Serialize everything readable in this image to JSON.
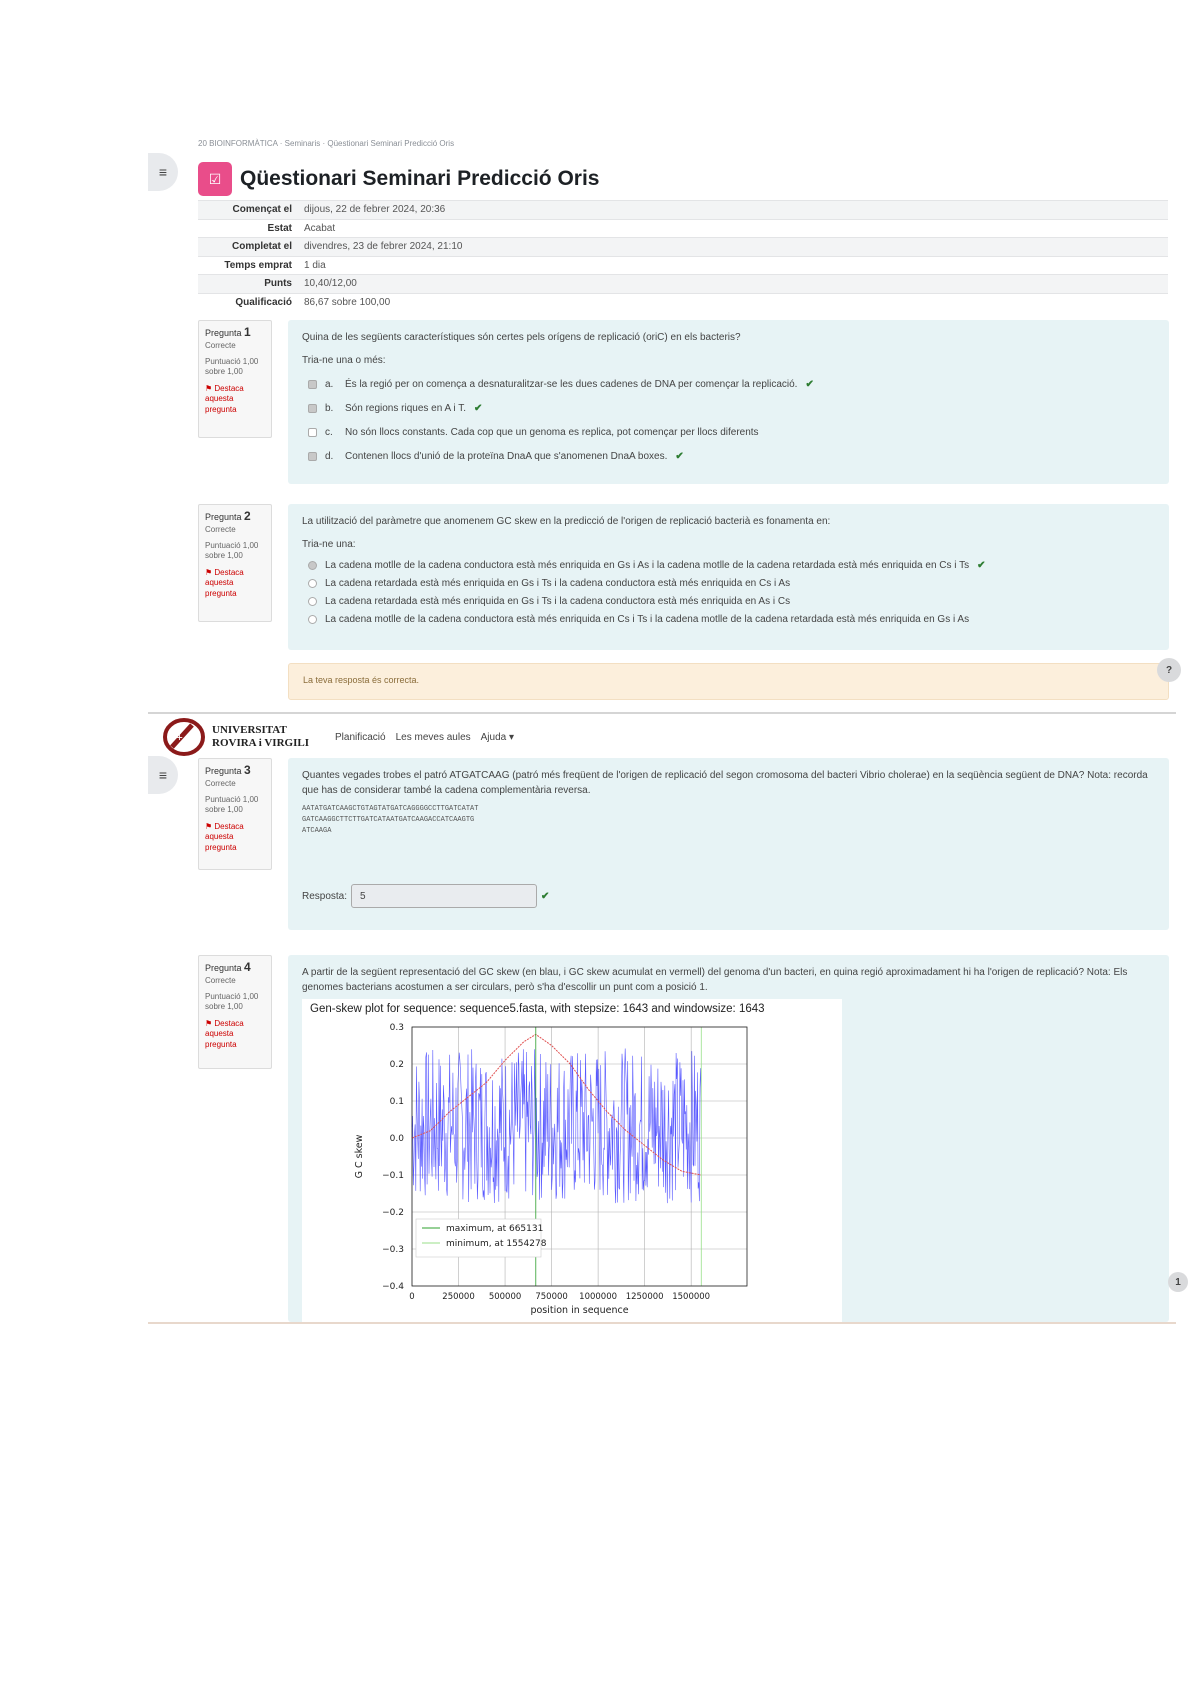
{
  "header": {
    "breadcrumb": "20 BIOINFORMÀTICA · Seminaris · Qüestionari Seminari Predicció Oris",
    "title": "Qüestionari Seminari Predicció Oris"
  },
  "summary": [
    {
      "label": "Començat el",
      "value": "dijous, 22 de febrer 2024, 20:36"
    },
    {
      "label": "Estat",
      "value": "Acabat"
    },
    {
      "label": "Completat el",
      "value": "divendres, 23 de febrer 2024, 21:10"
    },
    {
      "label": "Temps emprat",
      "value": "1 dia"
    },
    {
      "label": "Punts",
      "value": "10,40/12,00"
    },
    {
      "label": "Qualificació",
      "value": "86,67 sobre 100,00"
    }
  ],
  "questions": [
    {
      "no_label": "Pregunta",
      "no": "1",
      "state": "Correcte",
      "mark": "Puntuació 1,00 sobre 1,00",
      "flag": "Destaca aquesta pregunta",
      "text": "Quina de les següents característiques són certes pels orígens de replicació (oriC) en els bacteris?",
      "prompt": "Tria-ne una o més:",
      "options": [
        {
          "letter": "a.",
          "text": "És la regió per on comença a desnaturalitzar-se les dues cadenes de DNA per començar la replicació.",
          "checked": true,
          "correct": true
        },
        {
          "letter": "b.",
          "text": "Són regions riques en A i T.",
          "checked": true,
          "correct": true
        },
        {
          "letter": "c.",
          "text": "No són llocs constants. Cada cop que un genoma es replica, pot començar per llocs diferents",
          "checked": false,
          "correct": false
        },
        {
          "letter": "d.",
          "text": "Contenen llocs d'unió de la proteïna DnaA que s'anomenen DnaA boxes.",
          "checked": true,
          "correct": true
        }
      ]
    },
    {
      "no_label": "Pregunta",
      "no": "2",
      "state": "Correcte",
      "mark": "Puntuació 1,00 sobre 1,00",
      "flag": "Destaca aquesta pregunta",
      "text": "La utilització del paràmetre que anomenem GC skew en la predicció de l'origen de replicació bacterià es fonamenta en:",
      "prompt": "Tria-ne una:",
      "options": [
        {
          "text": "La cadena motlle de la cadena conductora està més enriquida en Gs i As i la cadena motlle de la cadena retardada està més enriquida en Cs i Ts",
          "checked": true,
          "correct": true
        },
        {
          "text": "La cadena retardada està més enriquida en Gs i Ts i la cadena conductora està més enriquida en Cs i As",
          "checked": false,
          "correct": false
        },
        {
          "text": "La cadena retardada està més enriquida en Gs i Ts i la cadena conductora està més enriquida en As i Cs",
          "checked": false,
          "correct": false
        },
        {
          "text": "La cadena motlle de la cadena conductora està més enriquida en Cs i Ts i la cadena motlle de la cadena retardada està més enriquida en Gs i As",
          "checked": false,
          "correct": false
        }
      ],
      "feedback": "La teva resposta és correcta."
    },
    {
      "no_label": "Pregunta",
      "no": "3",
      "state": "Correcte",
      "mark": "Puntuació 1,00 sobre 1,00",
      "flag": "Destaca aquesta pregunta",
      "text": "Quantes vegades trobes el patró ATGATCAAG (patró més freqüent de l'origen de replicació del segon cromosoma del bacteri Vibrio cholerae) en la seqüència següent de DNA? Nota: recorda que has de considerar també la cadena complementària reversa.",
      "sequence": [
        "AATATGATCAAGCTGTAGTATGATCAGGGGCCTTGATCATAT",
        "GATCAAGGCTTCTTGATCATAATGATCAAGACCATCAAGTG",
        "ATCAAGA"
      ],
      "answer_label": "Resposta:",
      "answer_value": "5"
    },
    {
      "no_label": "Pregunta",
      "no": "4",
      "state": "Correcte",
      "mark": "Puntuació 1,00 sobre 1,00",
      "flag": "Destaca aquesta pregunta",
      "text": "A partir de la següent representació del GC skew (en blau, i GC skew acumulat en vermell) del genoma d'un bacteri, en quina regió aproximadament hi ha l'origen de replicació? Nota: Els genomes bacterians acostumen a ser circulars, però s'ha d'escollir un punt com a posició 1."
    }
  ],
  "navbar": {
    "logo_line1": "UNIVERSITAT",
    "logo_line2": "ROVIRA i VIRGILI",
    "links": [
      "Planificació",
      "Les meves aules",
      "Ajuda ▾"
    ]
  },
  "help_label": "?",
  "chart_data": {
    "type": "line",
    "title": "Gen-skew plot for sequence: sequence5.fasta, with stepsize: 1643 and windowsize: 1643",
    "xlabel": "position in sequence",
    "ylabel": "G C skew",
    "xlim": [
      0,
      1800000
    ],
    "ylim": [
      -0.4,
      0.3
    ],
    "xticks": [
      0,
      250000,
      500000,
      750000,
      1000000,
      1250000,
      1500000
    ],
    "yticks": [
      -0.4,
      -0.3,
      -0.2,
      -0.1,
      0.0,
      0.1,
      0.2,
      0.3
    ],
    "grid": true,
    "legend_position": "lower-left",
    "series": [
      {
        "name": "maximum, at 665131",
        "color": "#2ca02c",
        "x": [
          665131
        ]
      },
      {
        "name": "minimum, at 1554278",
        "color": "#98df8a",
        "x": [
          1554278
        ]
      }
    ],
    "gc_skew": {
      "color": "#3b3bff",
      "x_range": [
        0,
        1554278
      ],
      "y_range": [
        -0.26,
        0.3
      ]
    },
    "cumulative_skew": {
      "color": "#e05050",
      "x": [
        0,
        100000,
        200000,
        300000,
        400000,
        500000,
        600000,
        665131,
        750000,
        850000,
        950000,
        1050000,
        1150000,
        1250000,
        1350000,
        1450000,
        1554278
      ],
      "y": [
        0.0,
        0.02,
        0.07,
        0.11,
        0.15,
        0.21,
        0.26,
        0.28,
        0.25,
        0.2,
        0.13,
        0.07,
        0.02,
        -0.02,
        -0.06,
        -0.09,
        -0.1
      ]
    }
  }
}
